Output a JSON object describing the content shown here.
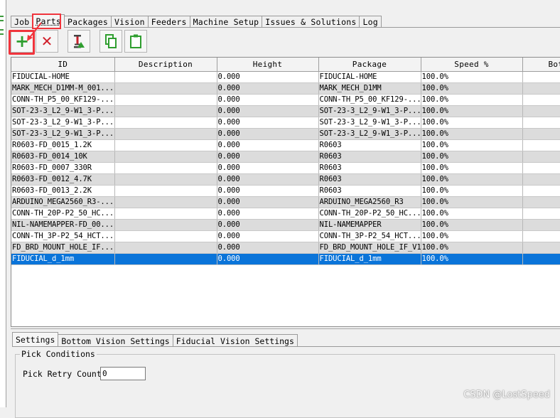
{
  "tabs": [
    "Job",
    "Parts",
    "Packages",
    "Vision",
    "Feeders",
    "Machine Setup",
    "Issues & Solutions",
    "Log"
  ],
  "active_tab": "Parts",
  "toolbar": {
    "icons": [
      "plus-icon",
      "delete-x-icon",
      "filter-icon",
      "copy-icon",
      "paste-icon"
    ],
    "colors": {
      "add": "#2f9e2f",
      "delete": "#d0202b",
      "annotation": "#f0343c"
    }
  },
  "table": {
    "columns": [
      "ID",
      "Description",
      "Height",
      "Package",
      "Speed %",
      "Bot"
    ],
    "rows": [
      [
        "FIDUCIAL-HOME",
        "",
        "0.000",
        "FIDUCIAL-HOME",
        "100.0%",
        ""
      ],
      [
        "MARK_MECH_D1MM-M_001...",
        "",
        "0.000",
        "MARK_MECH_D1MM",
        "100.0%",
        ""
      ],
      [
        "CONN-TH_P5_00_KF129-...",
        "",
        "0.000",
        "CONN-TH_P5_00_KF129-...",
        "100.0%",
        ""
      ],
      [
        "SOT-23-3_L2_9-W1_3-P...",
        "",
        "0.000",
        "SOT-23-3_L2_9-W1_3-P...",
        "100.0%",
        ""
      ],
      [
        "SOT-23-3_L2_9-W1_3-P...",
        "",
        "0.000",
        "SOT-23-3_L2_9-W1_3-P...",
        "100.0%",
        ""
      ],
      [
        "SOT-23-3_L2_9-W1_3-P...",
        "",
        "0.000",
        "SOT-23-3_L2_9-W1_3-P...",
        "100.0%",
        ""
      ],
      [
        "R0603-FD_0015_1.2K",
        "",
        "0.000",
        "R0603",
        "100.0%",
        ""
      ],
      [
        "R0603-FD_0014_10K",
        "",
        "0.000",
        "R0603",
        "100.0%",
        ""
      ],
      [
        "R0603-FD_0007_330R",
        "",
        "0.000",
        "R0603",
        "100.0%",
        ""
      ],
      [
        "R0603-FD_0012_4.7K",
        "",
        "0.000",
        "R0603",
        "100.0%",
        ""
      ],
      [
        "R0603-FD_0013_2.2K",
        "",
        "0.000",
        "R0603",
        "100.0%",
        ""
      ],
      [
        "ARDUINO_MEGA2560_R3-...",
        "",
        "0.000",
        "ARDUINO_MEGA2560_R3",
        "100.0%",
        ""
      ],
      [
        "CONN-TH_20P-P2_50_HC...",
        "",
        "0.000",
        "CONN-TH_20P-P2_50_HC...",
        "100.0%",
        ""
      ],
      [
        "NIL-NAMEMAPPER-FD_00...",
        "",
        "0.000",
        "NIL-NAMEMAPPER",
        "100.0%",
        ""
      ],
      [
        "CONN-TH_3P-P2_54_HCT...",
        "",
        "0.000",
        "CONN-TH_3P-P2_54_HCT...",
        "100.0%",
        ""
      ],
      [
        "FD_BRD_MOUNT_HOLE_IF...",
        "",
        "0.000",
        "FD_BRD_MOUNT_HOLE_IF_V1",
        "100.0%",
        ""
      ],
      [
        "FIDUCIAL_d_1mm",
        "",
        "0.000",
        "FIDUCIAL_d_1mm",
        "100.0%",
        ""
      ]
    ],
    "selected_row": 16
  },
  "bottom_tabs": [
    "Settings",
    "Bottom Vision Settings",
    "Fiducial Vision Settings"
  ],
  "pick_conditions": {
    "title": "Pick Conditions",
    "retry_label": "Pick Retry Count",
    "retry_value": "0"
  },
  "watermark": "CSDN @LostSpeed"
}
